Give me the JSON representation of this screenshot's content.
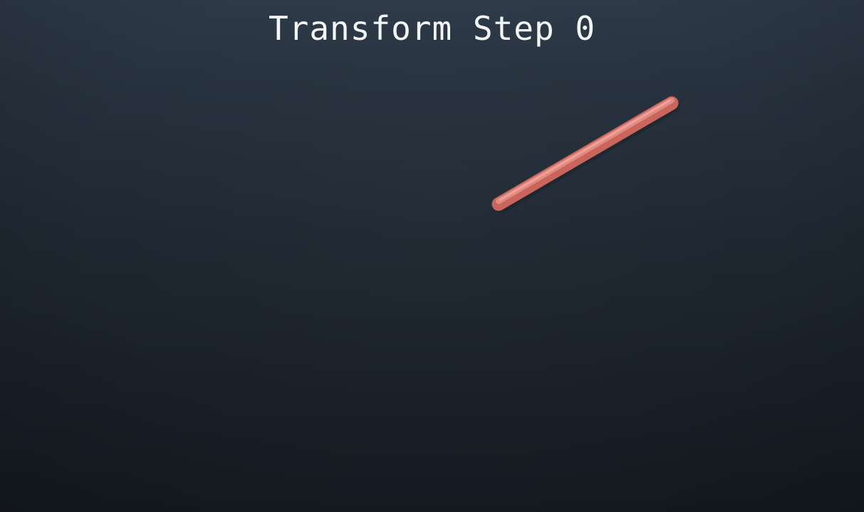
{
  "title": "Transform Step 0",
  "colors": {
    "rod": "#d9746a",
    "rod_highlight": "#ee9d94",
    "rod_shadow": "#a95147",
    "background_top": "#2e3a48",
    "background_bottom": "#151b21",
    "title_text": "#f4f5f6"
  },
  "objects": [
    {
      "name": "rod",
      "shape": "capsule"
    }
  ]
}
